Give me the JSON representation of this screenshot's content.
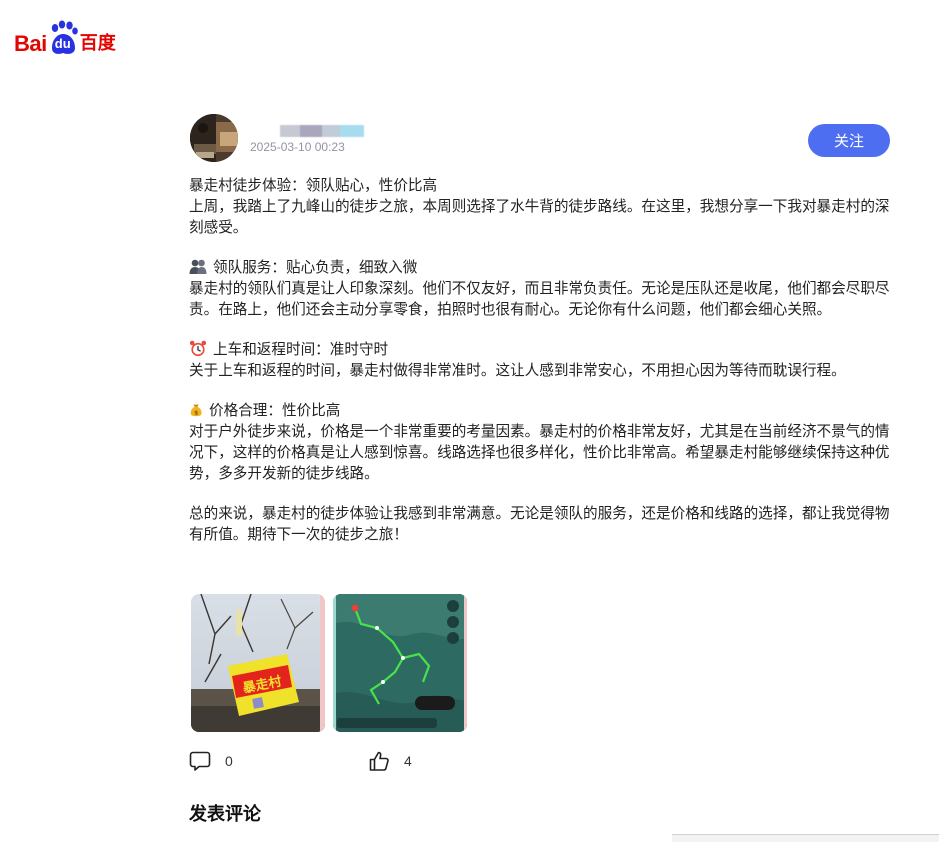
{
  "logo": {
    "text_left": "Bai",
    "text_right": "du",
    "text_cn": "百度"
  },
  "author": {
    "time": "2025-03-10 00:23",
    "follow_label": "关注"
  },
  "post": {
    "title": "暴走村徒步体验：领队贴心，性价比高",
    "intro": "上周，我踏上了九峰山的徒步之旅，本周则选择了水牛背的徒步路线。在这里，我想分享一下我对暴走村的深刻感受。",
    "sections": [
      {
        "icon": "people-icon",
        "heading": "领队服务：贴心负责，细致入微",
        "body": "暴走村的领队们真是让人印象深刻。他们不仅友好，而且非常负责任。无论是压队还是收尾，他们都会尽职尽责。在路上，他们还会主动分享零食，拍照时也很有耐心。无论你有什么问题，他们都会细心关照。"
      },
      {
        "icon": "alarm-clock-icon",
        "heading": "上车和返程时间：准时守时",
        "body": "关于上车和返程的时间，暴走村做得非常准时。这让人感到非常安心，不用担心因为等待而耽误行程。"
      },
      {
        "icon": "money-bag-icon",
        "heading": "价格合理：性价比高",
        "body": "对于户外徒步来说，价格是一个非常重要的考量因素。暴走村的价格非常友好，尤其是在当前经济不景气的情况下，这样的价格真是让人感到惊喜。线路选择也很多样化，性价比非常高。希望暴走村能够继续保持这种优势，多多开发新的徒步线路。"
      }
    ],
    "conclusion": "总的来说，暴走村的徒步体验让我感到非常满意。无论是领队的服务，还是价格和线路的选择，都让我觉得物有所值。期待下一次的徒步之旅！",
    "banner_text": "暴走村"
  },
  "actions": {
    "comments_count": "0",
    "likes_count": "4"
  },
  "comments": {
    "title": "发表评论"
  },
  "colors": {
    "brand_red": "#e10601",
    "follow_blue": "#4e6ef2",
    "muted_text": "#9195a3"
  }
}
